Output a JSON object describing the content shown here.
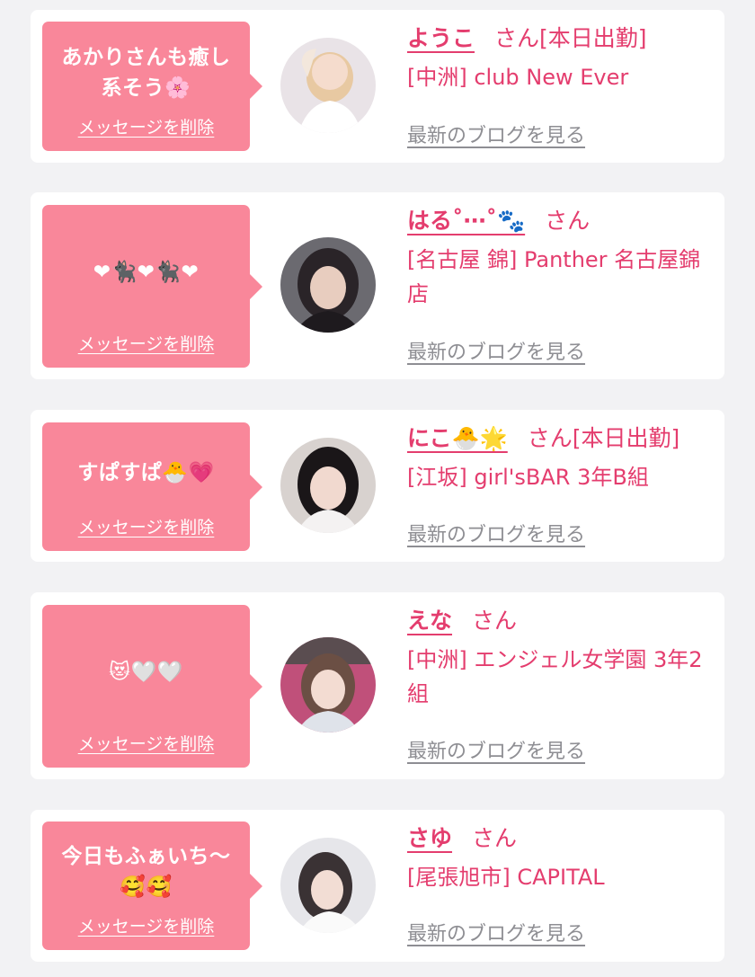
{
  "colors": {
    "accent": "#e43d6e",
    "bubble": "#f9879a",
    "background": "#f2f2f4",
    "muted": "#8e8e93"
  },
  "cards": [
    {
      "message": "あかりさんも癒し系そう🌸",
      "delete_label": "メッセージを削除",
      "name": "ようこ",
      "honorific": "さん",
      "status": "[本日出勤]",
      "shop": "[中洲] club New Ever",
      "blog_label": "最新のブログを見る"
    },
    {
      "message": "❤🐈‍⬛❤🐈‍⬛❤",
      "delete_label": "メッセージを削除",
      "name": "はる˚⋯˚🐾",
      "honorific": "さん",
      "status": "",
      "shop": "[名古屋 錦] Panther 名古屋錦店",
      "blog_label": "最新のブログを見る"
    },
    {
      "message": "すぱすぱ🐣💗",
      "delete_label": "メッセージを削除",
      "name": "にこ🐣🌟",
      "honorific": "さん",
      "status": "[本日出勤]",
      "shop": "[江坂] girl'sBAR 3年B組",
      "blog_label": "最新のブログを見る"
    },
    {
      "message": "😻🤍🤍",
      "delete_label": "メッセージを削除",
      "name": "えな",
      "honorific": "さん",
      "status": "",
      "shop": "[中洲] エンジェル女学園 3年2組",
      "blog_label": "最新のブログを見る"
    },
    {
      "message": "今日もふぁいち〜🥰🥰",
      "delete_label": "メッセージを削除",
      "name": "さゆ",
      "honorific": "さん",
      "status": "",
      "shop": "[尾張旭市] CAPITAL",
      "blog_label": "最新のブログを見る"
    }
  ]
}
